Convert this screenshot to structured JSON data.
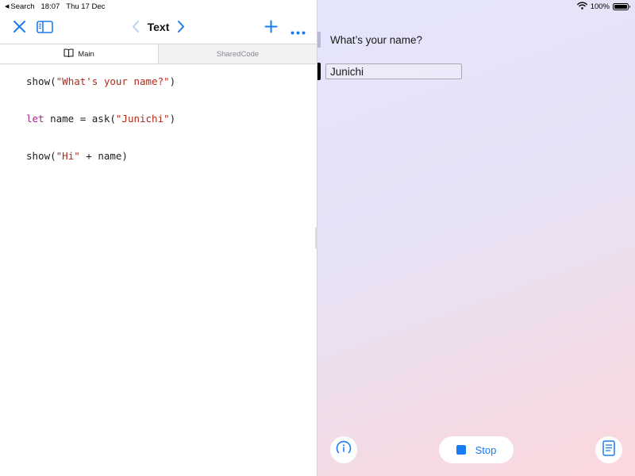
{
  "status_bar": {
    "back_app": "Search",
    "time": "18:07",
    "date": "Thu 17 Dec",
    "battery_percent": "100%",
    "battery_level": 1.0,
    "wifi_icon": "wifi-icon"
  },
  "toolbar": {
    "title": "Text",
    "icons": [
      "close-icon",
      "sidebar-icon",
      "chevron-left-icon",
      "chevron-right-icon",
      "plus-icon",
      "more-icon"
    ],
    "accent_color": "#1a7cf5"
  },
  "tabs": [
    {
      "label": "Main",
      "icon": "book-icon",
      "active": true
    },
    {
      "label": "SharedCode",
      "active": false
    }
  ],
  "code": {
    "line1": {
      "fn": "show(",
      "str": "\"What's your name?\"",
      "close": ")"
    },
    "line2": {
      "kw": "let",
      "rest": " name = ask(",
      "str": "\"Junichi\"",
      "close": ")"
    },
    "line3": {
      "fn": "show(",
      "str": "\"Hi\"",
      "rest": " + name)"
    }
  },
  "preview": {
    "prompt": "What’s your name?",
    "input_value": "Junichi",
    "stop_label": "Stop",
    "left_button_icon": "info-icon",
    "right_button_icon": "document-icon"
  }
}
